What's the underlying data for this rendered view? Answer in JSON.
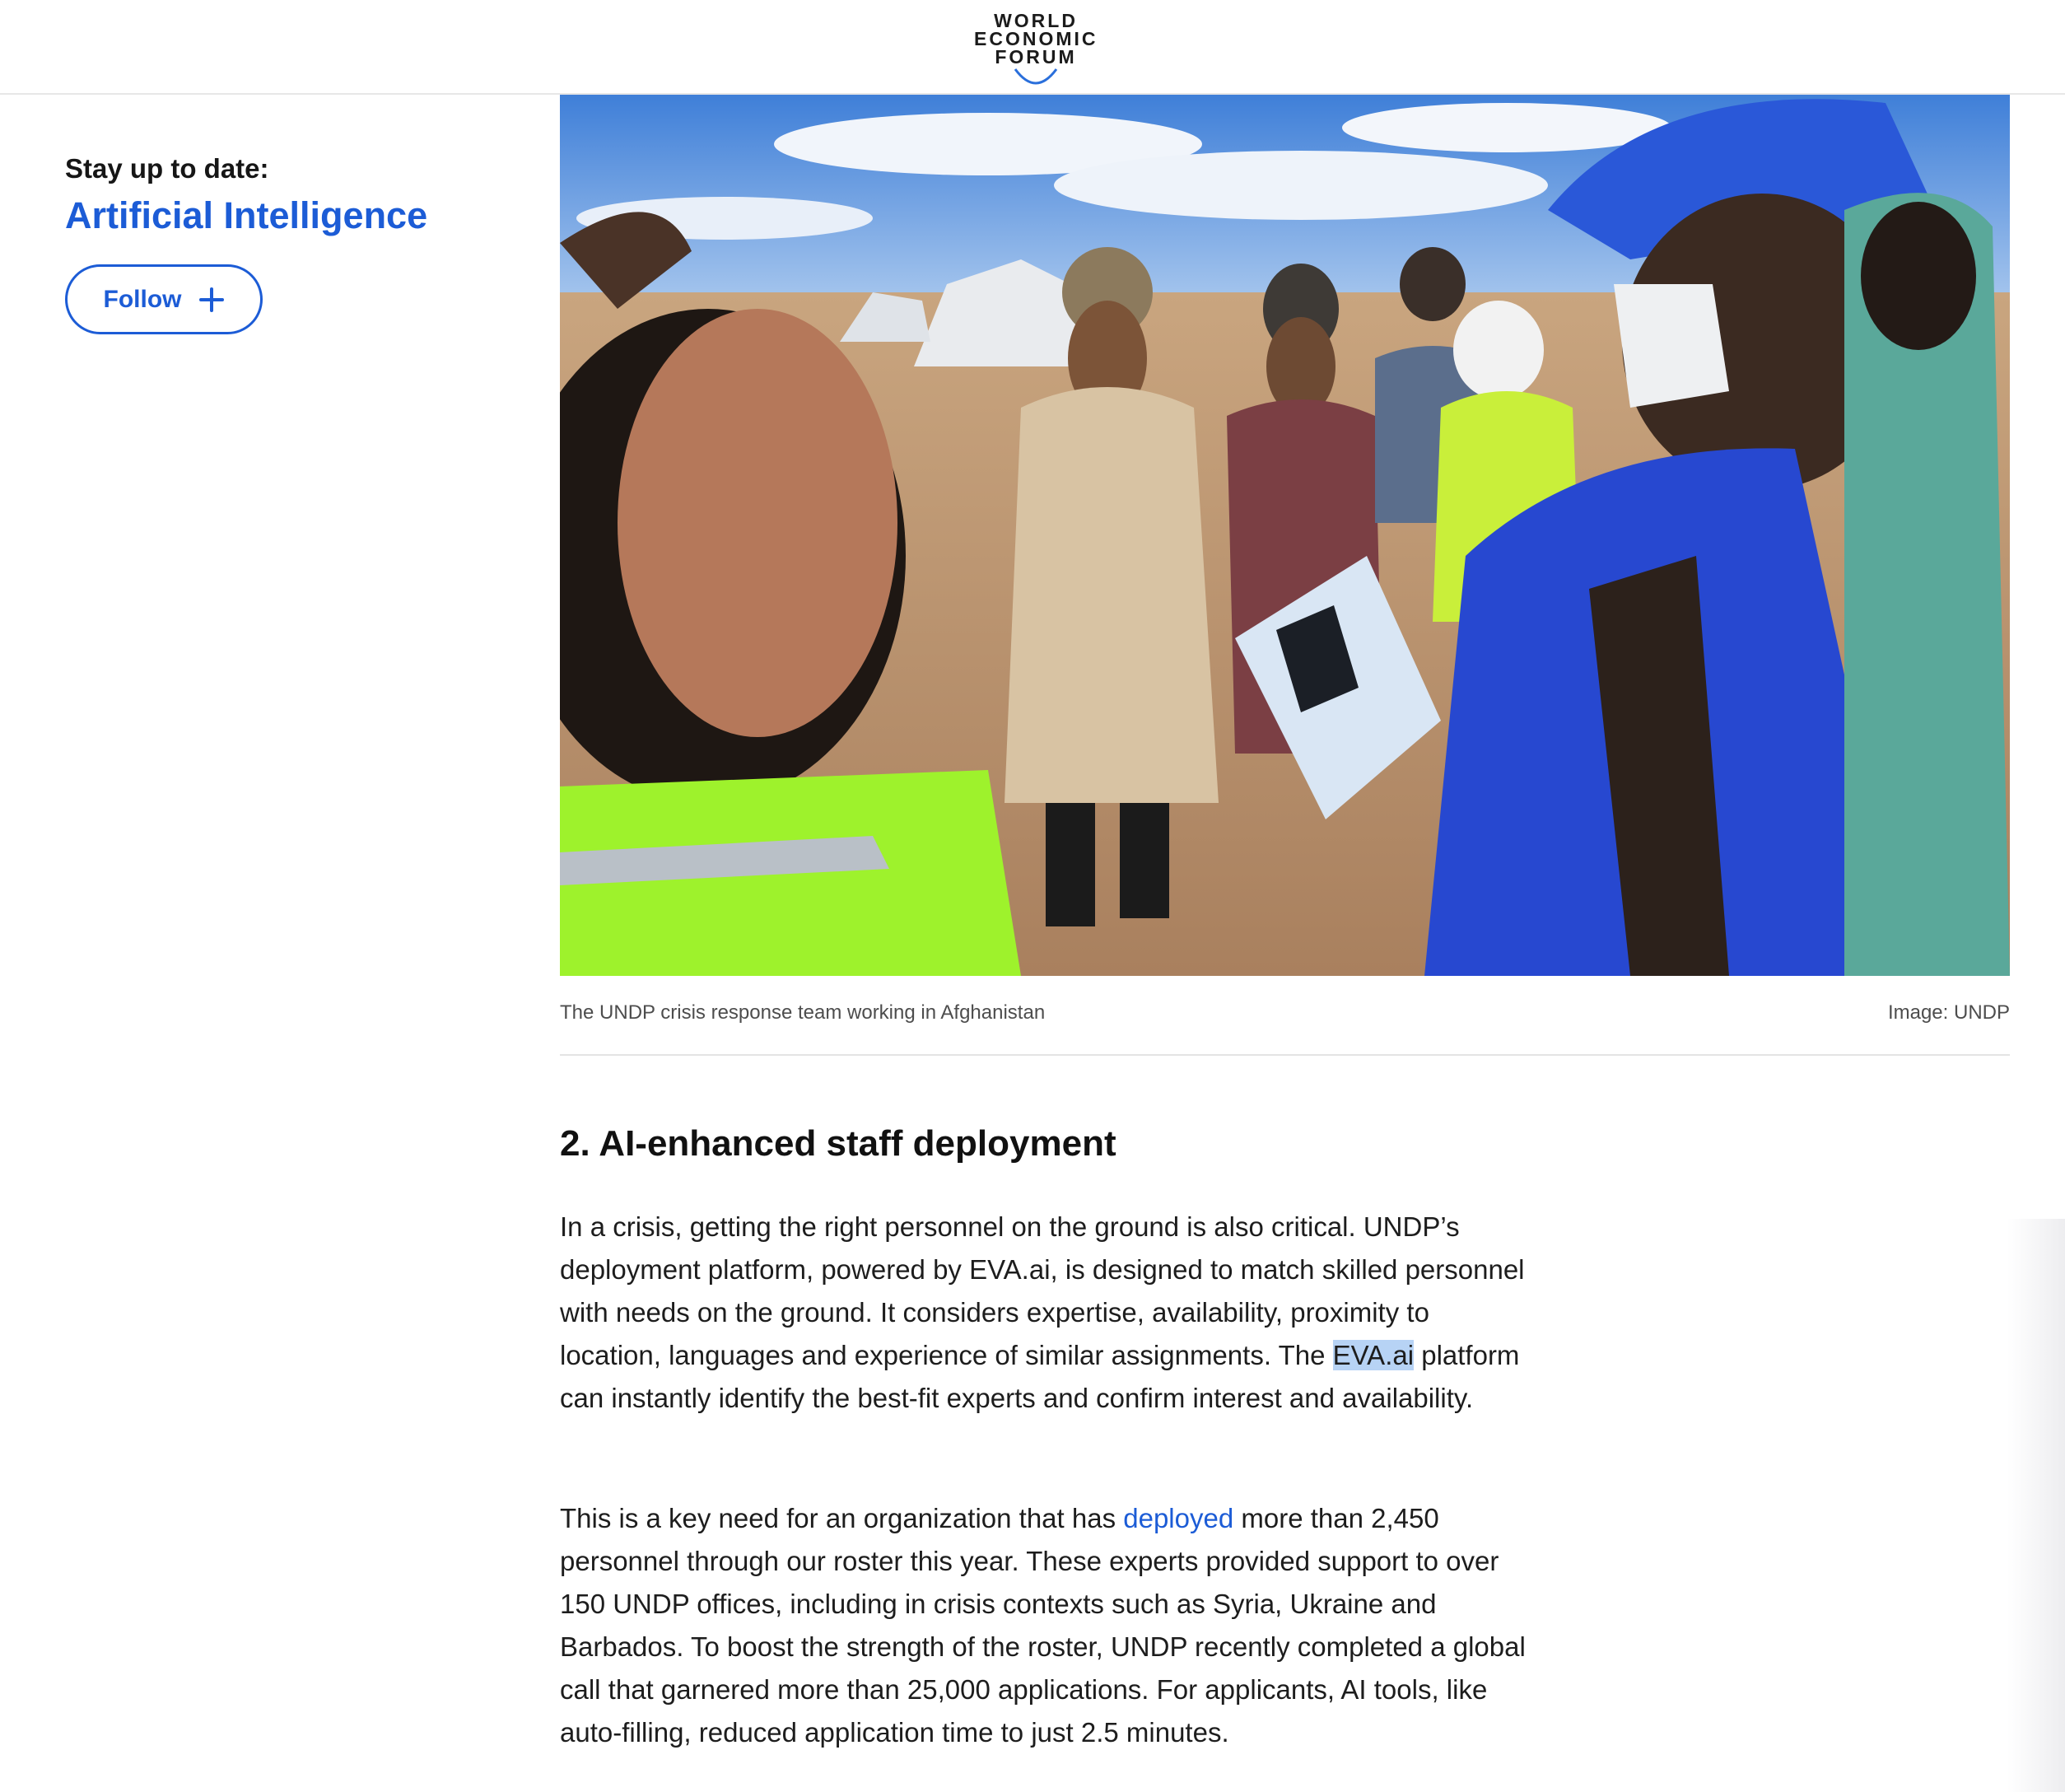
{
  "header": {
    "logo_line1": "WORLD",
    "logo_line2": "ECONOMIC",
    "logo_line3": "FORUM"
  },
  "sidebar": {
    "stay_label": "Stay up to date:",
    "topic": "Artificial Intelligence",
    "follow_label": "Follow",
    "follow_icon": "plus-icon"
  },
  "figure": {
    "alt": "The UNDP crisis response team working in Afghanistan",
    "caption": "The UNDP crisis response team working in Afghanistan",
    "credit": "Image: UNDP"
  },
  "article": {
    "heading": "2. AI-enhanced staff deployment",
    "p1_before": "In a crisis, getting the right personnel on the ground is also critical. UNDP’s deployment platform, powered by EVA.ai, is designed to match skilled personnel with needs on the ground. It considers expertise, availability, proximity to location, languages and experience of similar assignments. The ",
    "p1_highlight": "EVA.ai",
    "p1_after": " platform can instantly identify the best-fit experts and confirm interest and availability.",
    "p2_before": "This is a key need for an organization that has ",
    "p2_link": "deployed",
    "p2_after": " more than 2,450 personnel through our roster this year. These experts provided support to over 150 UNDP offices, including in crisis contexts such as Syria, Ukraine and Barbados. To boost the strength of the roster, UNDP recently completed a global call that garnered more than 25,000 applications. For applicants, AI tools, like auto-filling, reduced application time to just 2.5 minutes."
  },
  "colors": {
    "brand_blue": "#1c5cd6",
    "text": "#1d1d1d",
    "highlight": "#b7d3f5"
  }
}
